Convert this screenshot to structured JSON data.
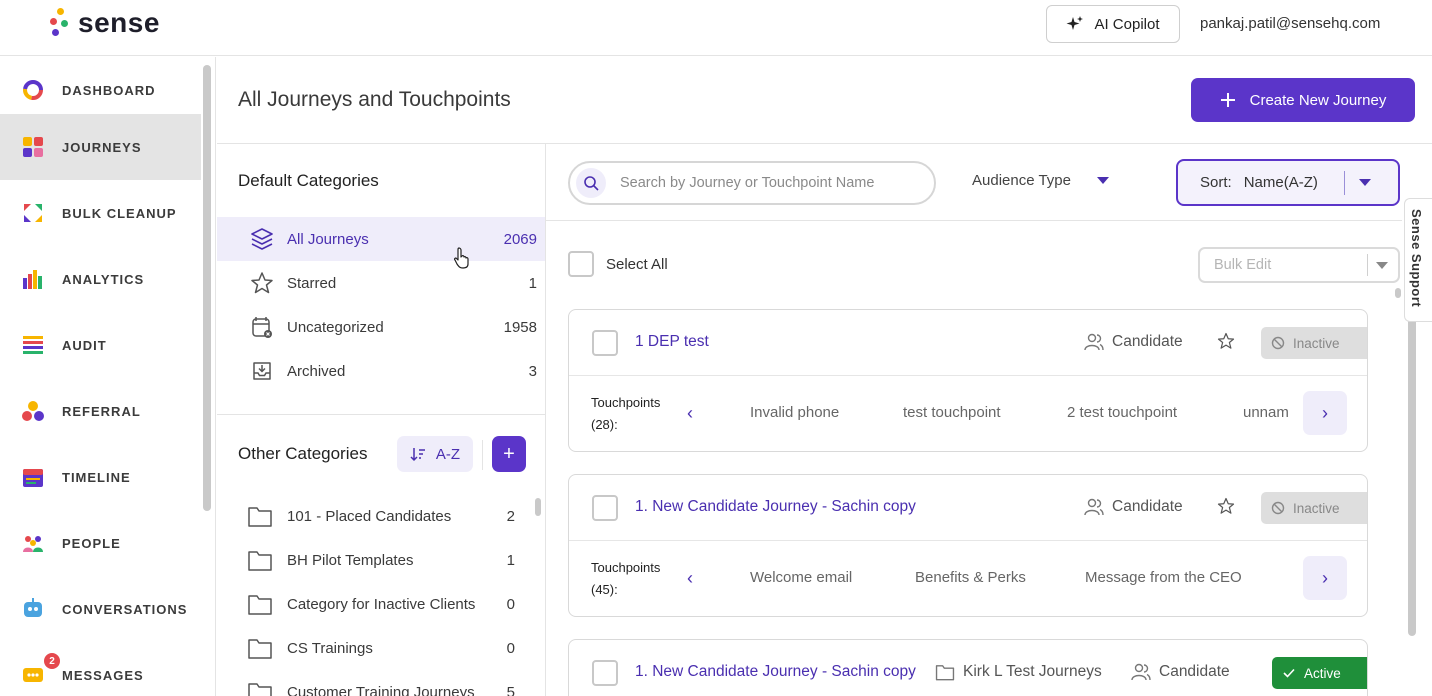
{
  "app": {
    "logo_text": "sense"
  },
  "topbar": {
    "copilot_label": "AI Copilot",
    "user_email": "pankaj.patil@sensehq.com"
  },
  "nav": {
    "items": [
      {
        "label": "DASHBOARD",
        "icon": "dashboard-icon"
      },
      {
        "label": "JOURNEYS",
        "icon": "journeys-icon",
        "active": true
      },
      {
        "label": "BULK CLEANUP",
        "icon": "bulk-cleanup-icon"
      },
      {
        "label": "ANALYTICS",
        "icon": "analytics-icon"
      },
      {
        "label": "AUDIT",
        "icon": "audit-icon"
      },
      {
        "label": "REFERRAL",
        "icon": "referral-icon"
      },
      {
        "label": "TIMELINE",
        "icon": "timeline-icon"
      },
      {
        "label": "PEOPLE",
        "icon": "people-icon"
      },
      {
        "label": "CONVERSATIONS",
        "icon": "conversations-icon"
      },
      {
        "label": "MESSAGES",
        "icon": "messages-icon",
        "badge": "2"
      }
    ]
  },
  "page": {
    "title": "All Journeys and Touchpoints",
    "create_label": "Create New Journey"
  },
  "categories": {
    "default_heading": "Default Categories",
    "default": [
      {
        "label": "All Journeys",
        "count": "2069",
        "icon": "layers-icon",
        "active": true
      },
      {
        "label": "Starred",
        "count": "1",
        "icon": "star-icon"
      },
      {
        "label": "Uncategorized",
        "count": "1958",
        "icon": "uncategorized-icon"
      },
      {
        "label": "Archived",
        "count": "3",
        "icon": "archive-icon"
      }
    ],
    "other_heading": "Other Categories",
    "sort_label": "A-Z",
    "add_label": "+",
    "other": [
      {
        "label": "101 - Placed Candidates",
        "count": "2"
      },
      {
        "label": "BH Pilot Templates",
        "count": "1"
      },
      {
        "label": "Category for Inactive Clients",
        "count": "0"
      },
      {
        "label": "CS Trainings",
        "count": "0"
      },
      {
        "label": "Customer Training Journeys",
        "count": "5"
      }
    ]
  },
  "filters": {
    "search_placeholder": "Search by Journey or Touchpoint Name",
    "audience_label": "Audience Type",
    "sort_prefix": "Sort:",
    "sort_value": "Name(A-Z)",
    "select_all_label": "Select All",
    "bulk_edit_label": "Bulk Edit"
  },
  "journeys": [
    {
      "title": "1 DEP test",
      "audience": "Candidate",
      "status": "Inactive",
      "touchpoints_label": "Touchpoints",
      "touchpoints_count": "(28):",
      "touchpoints": [
        "Invalid phone",
        "test touchpoint",
        "2 test touchpoint",
        "unnam"
      ]
    },
    {
      "title": "1. New Candidate Journey - Sachin copy",
      "audience": "Candidate",
      "status": "Inactive",
      "touchpoints_label": "Touchpoints",
      "touchpoints_count": "(45):",
      "touchpoints": [
        "Welcome email",
        "Benefits & Perks",
        "Message from the CEO"
      ]
    },
    {
      "title": "1. New Candidate Journey - Sachin copy",
      "category": "Kirk L Test Journeys",
      "audience": "Candidate",
      "status": "Active"
    }
  ],
  "support": {
    "label": "Sense Support"
  },
  "colors": {
    "accent": "#5b35c9",
    "active_status": "#1f8f3a",
    "inactive_status": "#dedede"
  }
}
